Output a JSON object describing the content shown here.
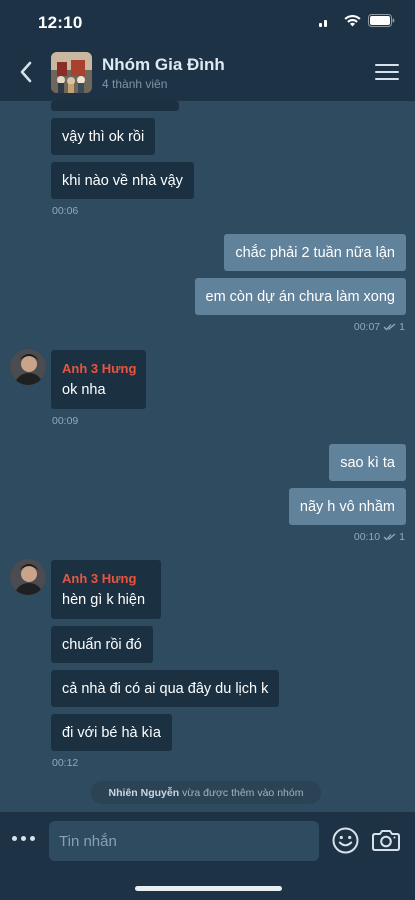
{
  "status_bar": {
    "time": "12:10"
  },
  "header": {
    "title": "Nhóm Gia Đình",
    "subtitle": "4 thành viên"
  },
  "messages": [
    {
      "direction": "in",
      "text": "vậy thì ok rồi"
    },
    {
      "direction": "in",
      "text": "khi nào về nhà vậy"
    },
    {
      "stamp": "00:06"
    },
    {
      "direction": "out",
      "text": "chắc phải 2 tuần nữa lận"
    },
    {
      "direction": "out",
      "text": "em còn dự án chưa làm xong"
    },
    {
      "stamp": "00:07",
      "read_count": "1"
    },
    {
      "direction": "in",
      "sender": "Anh 3 Hưng",
      "text": "ok nha"
    },
    {
      "stamp": "00:09"
    },
    {
      "direction": "out",
      "text": "sao kì ta"
    },
    {
      "direction": "out",
      "text": "nãy h vô nhầm"
    },
    {
      "stamp": "00:10",
      "read_count": "1"
    },
    {
      "direction": "in",
      "sender": "Anh 3 Hưng",
      "text": "hèn gì k hiện"
    },
    {
      "direction": "in",
      "text": "chuẩn rồi đó"
    },
    {
      "direction": "in",
      "text": "cả nhà đi có ai qua đây du lịch k"
    },
    {
      "direction": "in",
      "text": "đi với bé hà kìa"
    },
    {
      "stamp": "00:12"
    }
  ],
  "system_message": {
    "name": "Nhiên Nguyễn",
    "text": "vừa được thêm vào nhóm"
  },
  "composer": {
    "placeholder": "Tin nhắn"
  },
  "colors": {
    "background": "#2f4b5f",
    "bar": "#1d3345",
    "incoming_bubble": "#1b3142",
    "outgoing_bubble": "#61829b",
    "sender_name": "#e8553f"
  },
  "icons": [
    "back-icon",
    "menu-icon",
    "more-icon",
    "emoji-icon",
    "camera-icon",
    "wifi-icon",
    "battery-icon",
    "signal-icon",
    "read-check-icon"
  ]
}
